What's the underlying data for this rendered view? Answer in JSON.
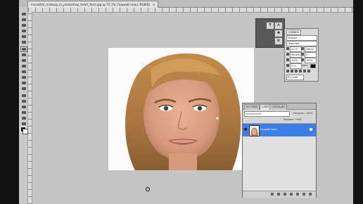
{
  "document": {
    "tab_title": "morskikh_makeup_in_photoshop_heart_face.jpg @ 75,1% (Задний план, RGB/8)",
    "close_glyph": "×"
  },
  "toolbar": {
    "tools": [
      "move-icon",
      "marquee-icon",
      "lasso-icon",
      "quick-select-icon",
      "crop-icon",
      "eyedropper-icon",
      "spot-heal-icon",
      "brush-icon",
      "clone-stamp-icon",
      "history-brush-icon",
      "eraser-icon",
      "gradient-icon",
      "blur-icon",
      "dodge-icon",
      "pen-icon",
      "type-icon",
      "path-select-icon",
      "shape-icon",
      "hand-icon",
      "zoom-icon"
    ],
    "active_tool": "spot-heal-icon",
    "foreground_color": "#000000",
    "background_color": "#ffffff"
  },
  "mini_panels": {
    "items": [
      "¶",
      "A",
      "✱",
      "⚙"
    ]
  },
  "character_panel": {
    "tab": "СИМВОЛ",
    "font_family": "Tahoma",
    "font_style": "Обычный",
    "font_size": "12 пт",
    "leading": "(Авто)",
    "kerning": "Метрич.",
    "tracking": "0",
    "vscale": "100%",
    "hscale": "100%",
    "baseline": "0 пт",
    "color_label": "Цвет:",
    "language": "Русский"
  },
  "layers_panel": {
    "tabs": [
      "ИСТОРИЯ",
      "СЛОИ",
      "ОПЕРАЦИИ"
    ],
    "active_tab": "СЛОИ",
    "blend_mode": "Нормальный",
    "opacity_label": "Непрозр.: 100%",
    "fill_label": "Заливка: 100%",
    "layers": [
      {
        "name": "Задний план",
        "visible": true,
        "selected": true,
        "locked": true
      }
    ],
    "selected_color": "#3d7fe6"
  }
}
